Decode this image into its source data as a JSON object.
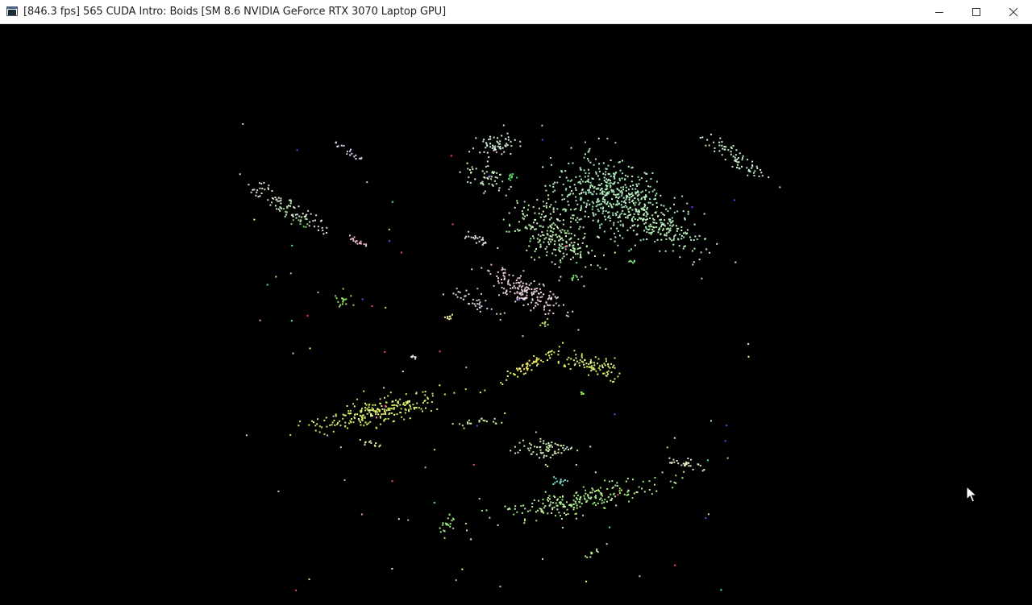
{
  "window": {
    "title": "[846.3 fps] 565 CUDA Intro: Boids [SM 8.6 NVIDIA GeForce RTX 3070 Laptop GPU]",
    "icon": "console-window-icon",
    "controls": {
      "minimize": "minimize-icon",
      "maximize": "maximize-icon",
      "close": "close-icon"
    }
  },
  "scene": {
    "background": "#000000",
    "cursor": "arrow-cursor-icon"
  }
}
